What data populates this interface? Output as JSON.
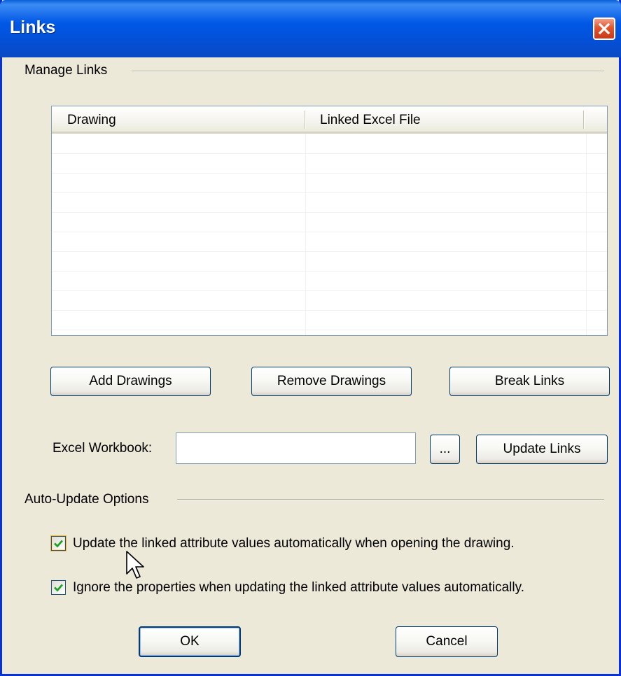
{
  "window": {
    "title": "Links",
    "close_icon": "close-icon"
  },
  "manage_links": {
    "group_label": "Manage Links",
    "columns": [
      "Drawing",
      "Linked Excel File"
    ],
    "rows": []
  },
  "buttons": {
    "add_drawings": "Add Drawings",
    "remove_drawings": "Remove Drawings",
    "break_links": "Break Links",
    "browse": "...",
    "update_links": "Update Links",
    "ok": "OK",
    "cancel": "Cancel"
  },
  "excel_workbook": {
    "label": "Excel Workbook:",
    "value": ""
  },
  "auto_update": {
    "group_label": "Auto-Update Options",
    "options": [
      {
        "label": "Update the linked attribute values automatically when opening the drawing.",
        "checked": true
      },
      {
        "label": "Ignore the properties when updating the linked attribute values automatically.",
        "checked": true
      }
    ]
  },
  "colors": {
    "titlebar": "#0058e6",
    "dialog_bg": "#ece9d8",
    "checkmark": "#21a121",
    "close_button": "#e2542c"
  }
}
